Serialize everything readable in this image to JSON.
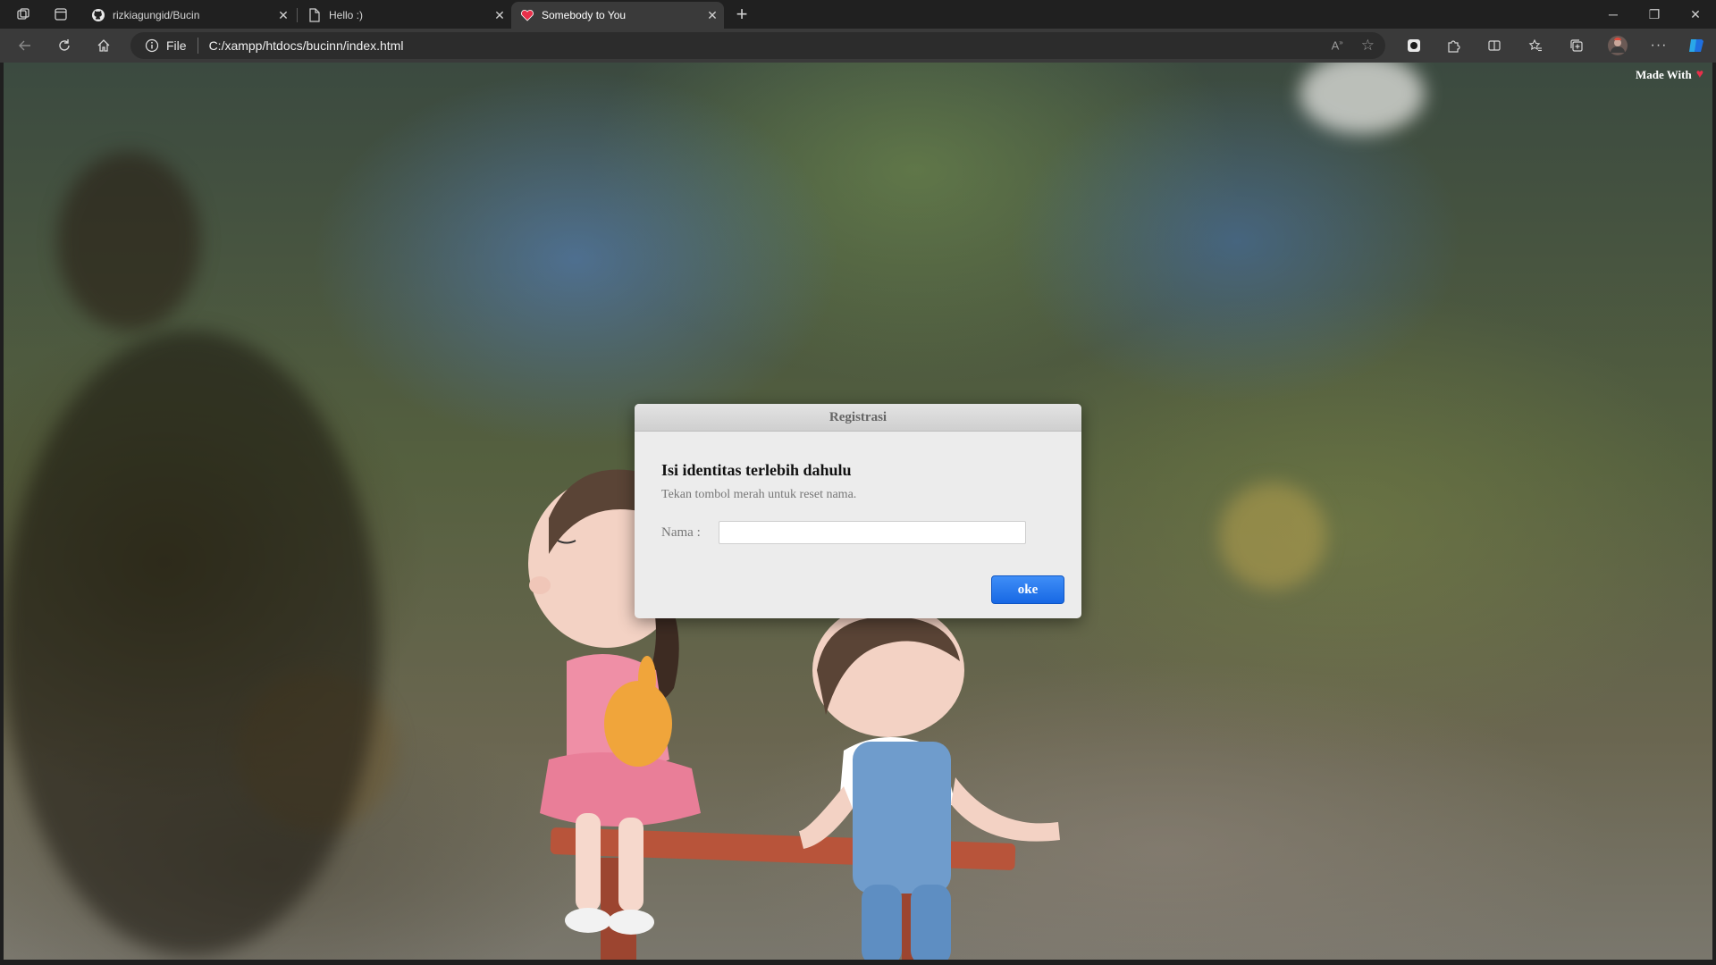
{
  "browser": {
    "tabs": [
      {
        "label": "rizkiagungid/Bucin",
        "icon": "github-icon",
        "active": false
      },
      {
        "label": "Hello :)",
        "icon": "page-icon",
        "active": false
      },
      {
        "label": "Somebody to You",
        "icon": "heart-icon",
        "active": true
      }
    ],
    "address": {
      "info_label": "File",
      "url": "C:/xampp/htdocs/bucinn/index.html"
    }
  },
  "page": {
    "made_with": "Made With",
    "modal": {
      "header": "Registrasi",
      "title": "Isi identitas terlebih dahulu",
      "subtitle": "Tekan tombol merah untuk reset nama.",
      "name_label": "Nama :",
      "name_value": "",
      "ok_label": "oke"
    }
  },
  "colors": {
    "ok_button": "#1d6ff0",
    "heart": "#e8304a"
  }
}
